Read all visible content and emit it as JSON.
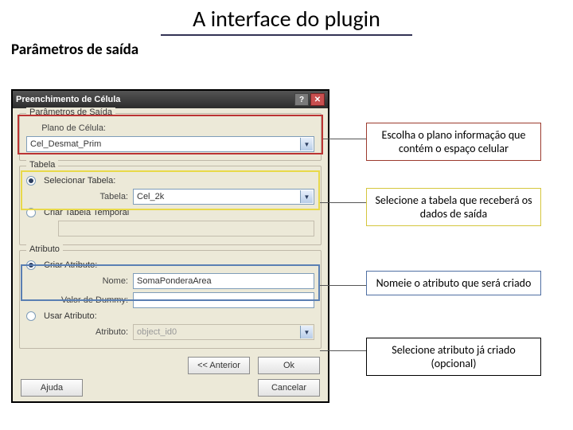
{
  "slide": {
    "title": "A interface do plugin",
    "subtitle": "Parâmetros de saída"
  },
  "dialog": {
    "title": "Preenchimento de Célula",
    "group_params": {
      "legend": "Parâmetros de Saída",
      "plano_label": "Plano de Célula:",
      "plano_value": "Cel_Desmat_Prim"
    },
    "group_tabela": {
      "legend": "Tabela",
      "radio_selecionar": "Selecionar Tabela:",
      "tabela_label": "Tabela:",
      "tabela_value": "Cel_2k",
      "chk_temporal": "Criar Tabela Temporal"
    },
    "group_atributo": {
      "legend": "Atributo",
      "radio_criar": "Criar Atributo:",
      "nome_label": "Nome:",
      "nome_value": "SomaPonderaArea",
      "dummy_label": "Valor de Dummy:",
      "dummy_value": "",
      "radio_usar": "Usar Atributo:",
      "atributo_label": "Atributo:",
      "atributo_value": "object_id0"
    },
    "buttons": {
      "help": "Ajuda",
      "prev": "<< Anterior",
      "ok": "Ok",
      "cancel": "Cancelar"
    }
  },
  "annotations": {
    "a1": "Escolha o plano informação que contém o espaço celular",
    "a2": "Selecione a tabela que receberá os dados de saída",
    "a3": "Nomeie o atributo que será criado",
    "a4": "Selecione atributo já criado (opcional)"
  }
}
